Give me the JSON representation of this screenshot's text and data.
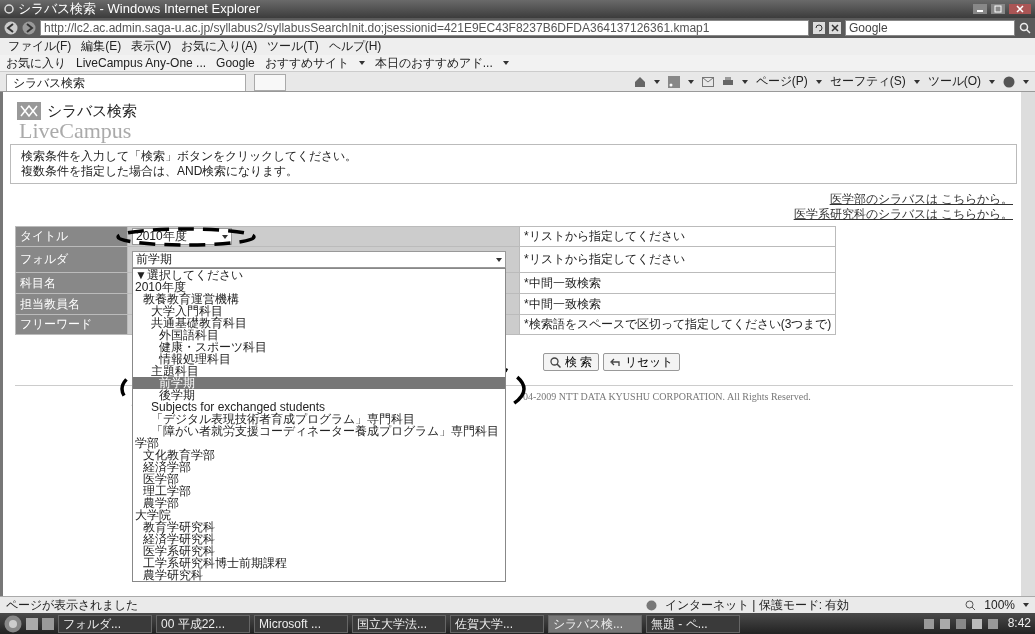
{
  "window": {
    "title": "シラバス検索 - Windows Internet Explorer"
  },
  "address_bar": {
    "url": "http://lc2.ac.admin.saga-u.ac.jp/syllabus2/syllabusSearchInit.do;jsessionid=421E9EC43F8237B6DFDA364137126361.kmap1"
  },
  "search_box": {
    "value": "Google"
  },
  "menu": [
    "ファイル(F)",
    "編集(E)",
    "表示(V)",
    "お気に入り(A)",
    "ツール(T)",
    "ヘルプ(H)"
  ],
  "favorites_bar": [
    "お気に入り",
    "LiveCampus Any-One ...",
    "Google",
    "おすすめサイト",
    "本日のおすすめアド..."
  ],
  "tabs": [
    {
      "label": "シラバス検索",
      "selected": true
    }
  ],
  "command_bar": [
    "ページ(P)",
    "セーフティ(S)",
    "ツール(O)"
  ],
  "page": {
    "heading": "シラバス検索",
    "watermark": "LiveCampus",
    "instructions": [
      "検索条件を入力して「検索」ボタンをクリックしてください。",
      "複数条件を指定した場合は、AND検索になります。"
    ],
    "links": [
      "医学部のシラバスは こちらから。",
      "医学系研究科のシラバスは こちらから。"
    ],
    "form": [
      {
        "label": "タイトル",
        "kind": "select",
        "value": "2010年度",
        "hint": "*リストから指定してください"
      },
      {
        "label": "フォルダ",
        "kind": "select",
        "value": "前学期",
        "hint": "*リストから指定してください"
      },
      {
        "label": "科目名",
        "kind": "text",
        "hint": "*中間一致検索"
      },
      {
        "label": "担当教員名",
        "kind": "text",
        "hint": "*中間一致検索"
      },
      {
        "label": "フリーワード",
        "kind": "text",
        "hint": "*検索語をスペースで区切って指定してください(3つまで)"
      }
    ],
    "buttons": [
      "検 索",
      "リセット"
    ],
    "copyright": "04-2009 NTT DATA KYUSHU CORPORATION. All Rights Reserved."
  },
  "dropdown": {
    "options": [
      {
        "label": "▼選択してください",
        "selected": false
      },
      {
        "label": "2010年度",
        "selected": false,
        "children": [
          {
            "label": "教養教育運営機構",
            "selected": false,
            "children": [
              {
                "label": "大学入門科目",
                "selected": false
              },
              {
                "label": "共通基礎教育科目",
                "selected": false,
                "children": [
                  {
                    "label": "外国語科目",
                    "selected": false
                  },
                  {
                    "label": "健康・スポーツ科目",
                    "selected": false
                  },
                  {
                    "label": "情報処理科目",
                    "selected": false
                  }
                ]
              },
              {
                "label": "主題科目",
                "selected": false,
                "children": [
                  {
                    "label": "前学期",
                    "selected": true
                  },
                  {
                    "label": "後学期",
                    "selected": false
                  }
                ]
              },
              {
                "label": "Subjects for exchanged students",
                "selected": false
              },
              {
                "label": "「デジタル表現技術者育成プログラム」専門科目",
                "selected": false
              },
              {
                "label": "「障がい者就労支援コーディネーター養成プログラム」専門科目",
                "selected": false
              }
            ]
          }
        ]
      },
      {
        "label": "学部",
        "selected": false,
        "children": [
          {
            "label": "文化教育学部",
            "selected": false
          },
          {
            "label": "経済学部",
            "selected": false
          },
          {
            "label": "医学部",
            "selected": false
          },
          {
            "label": "理工学部",
            "selected": false
          },
          {
            "label": "農学部",
            "selected": false
          }
        ]
      },
      {
        "label": "大学院",
        "selected": false,
        "children": [
          {
            "label": "教育学研究科",
            "selected": false
          },
          {
            "label": "経済学研究科",
            "selected": false
          },
          {
            "label": "医学系研究科",
            "selected": false
          },
          {
            "label": "工学系研究科博士前期課程",
            "selected": false
          },
          {
            "label": "農学研究科",
            "selected": false
          }
        ]
      }
    ]
  },
  "status_bar": {
    "message": "ページが表示されました",
    "zone": "インターネット | 保護モード: 有効",
    "zoom": "100%"
  },
  "taskbar": {
    "items": [
      {
        "label": "フォルダ...",
        "selected": false
      },
      {
        "label": "00 平成22...",
        "selected": false
      },
      {
        "label": "Microsoft ...",
        "selected": false
      },
      {
        "label": "国立大学法...",
        "selected": false
      },
      {
        "label": "佐賀大学...",
        "selected": false
      },
      {
        "label": "シラバス検...",
        "selected": true
      },
      {
        "label": "無題 - ペ...",
        "selected": false
      }
    ],
    "clock": "8:42"
  }
}
